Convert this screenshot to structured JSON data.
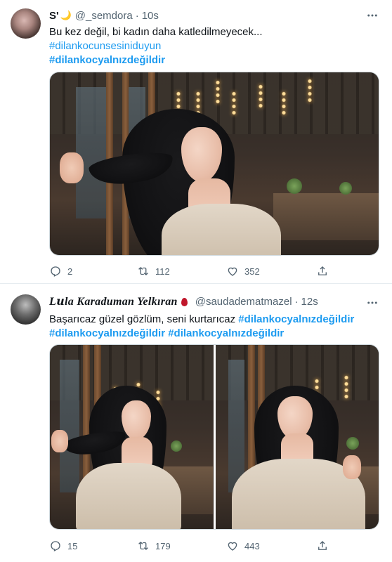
{
  "tweets": [
    {
      "name": "S'",
      "name_emoji": "🌙",
      "handle": "@_semdora",
      "separator": "·",
      "time": "10s",
      "lines": [
        {
          "text": "Bu kez değil,  bi kadın daha katledilmeyecek...",
          "kind": "plain"
        },
        {
          "text": "#dilankocunsesiniduyun",
          "kind": "hashtag"
        },
        {
          "text": "#dilankocyalnızdeğildir",
          "kind": "hashtag-bold"
        }
      ],
      "stats": {
        "replies": "2",
        "retweets": "112",
        "likes": "352"
      }
    },
    {
      "name": "L𝒖la Karaduman Yelkıran",
      "handle": "@saudadematmazel",
      "separator": "·",
      "time": "12s",
      "lines": [
        {
          "text": "Başarıcaz güzel gözlüm, seni kurtarıcaz ",
          "kind": "plain",
          "tail": "#dilankocyalnızdeğildir"
        },
        {
          "text": "#dilankocyalnızdeğildir #dilankocyalnızdeğildir",
          "kind": "hashtag-bold"
        }
      ],
      "stats": {
        "replies": "15",
        "retweets": "179",
        "likes": "443"
      }
    }
  ],
  "icons": {
    "more": "more-horizontal-icon",
    "reply": "reply-icon",
    "retweet": "retweet-icon",
    "like": "heart-icon",
    "share": "share-icon"
  },
  "colors": {
    "accent": "#1d9bf0",
    "muted": "#536471",
    "divider": "#e6ecf0",
    "text": "#0f1419"
  }
}
